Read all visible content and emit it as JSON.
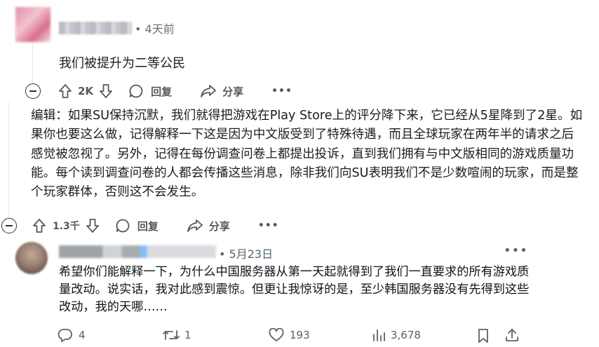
{
  "comment": {
    "meta": "• 4天前",
    "body": "我们被提升为二等公民",
    "actions": {
      "upvote_count": "2K",
      "reply_label": "回复",
      "share_label": "分享",
      "more": "•••"
    }
  },
  "edit_comment": {
    "body": "编辑：如果SU保持沉默，我们就得把游戏在Play Store上的评分降下来，它已经从5星降到了2星。如果你也要这么做，记得解释一下这是因为中文版受到了特殊待遇，而且全球玩家在两年半的请求之后感觉被忽视了。另外，记得在每份调查问卷上都提出投诉，直到我们拥有与中文版相同的游戏质量功能。每个读到调查问卷的人都会传播这些消息，除非我们向SU表明我们不是少数喧闹的玩家，而是整个玩家群体，否则这不会发生。",
    "actions": {
      "upvote_count": "1.3千",
      "reply_label": "回复",
      "share_label": "分享",
      "more": "•••"
    }
  },
  "tweet": {
    "meta": "• 5月23日",
    "more": "•••",
    "body": "希望你们能解释一下，为什么中国服务器从第一天起就得到了我们一直要求的所有游戏质量改动。说实话，我对此感到震惊。但更让我惊讶的是，至少韩国服务器没有先得到这些改动，我的天哪……",
    "stats": {
      "replies": "4",
      "retweets": "1",
      "likes": "193",
      "views": "3,678"
    }
  }
}
